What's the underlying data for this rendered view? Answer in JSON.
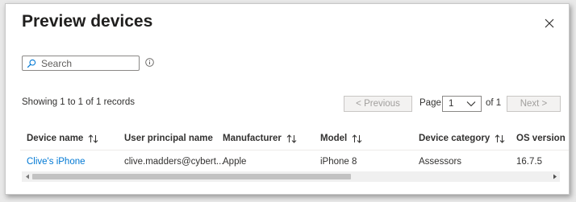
{
  "dialog": {
    "title": "Preview devices",
    "close_icon": "close-icon"
  },
  "search": {
    "placeholder": "Search",
    "value": "",
    "icon": "search-icon",
    "info_icon": "info-icon"
  },
  "records": {
    "summary": "Showing 1 to 1 of 1 records"
  },
  "pagination": {
    "previous_label": "< Previous",
    "next_label": "Next >",
    "page_label": "Page",
    "current_page": "1",
    "of_label": "of 1",
    "previous_enabled": false,
    "next_enabled": false
  },
  "table": {
    "columns": [
      {
        "label": "Device name",
        "sortable": true
      },
      {
        "label": "User principal name",
        "sortable": false
      },
      {
        "label": "Manufacturer",
        "sortable": true
      },
      {
        "label": "Model",
        "sortable": true
      },
      {
        "label": "Device category",
        "sortable": true
      },
      {
        "label": "OS version",
        "sortable": false
      }
    ],
    "rows": [
      {
        "device_name": "Clive's iPhone",
        "user_principal_name": "clive.madders@cybert...",
        "manufacturer": "Apple",
        "model": "iPhone 8",
        "device_category": "Assessors",
        "os_version": "16.7.5"
      }
    ]
  },
  "scrollbar": {
    "horizontal_position": 0
  },
  "colors": {
    "link": "#0078d4",
    "text": "#323130",
    "disabled_text": "#a19f9d",
    "border": "#8a8886"
  }
}
